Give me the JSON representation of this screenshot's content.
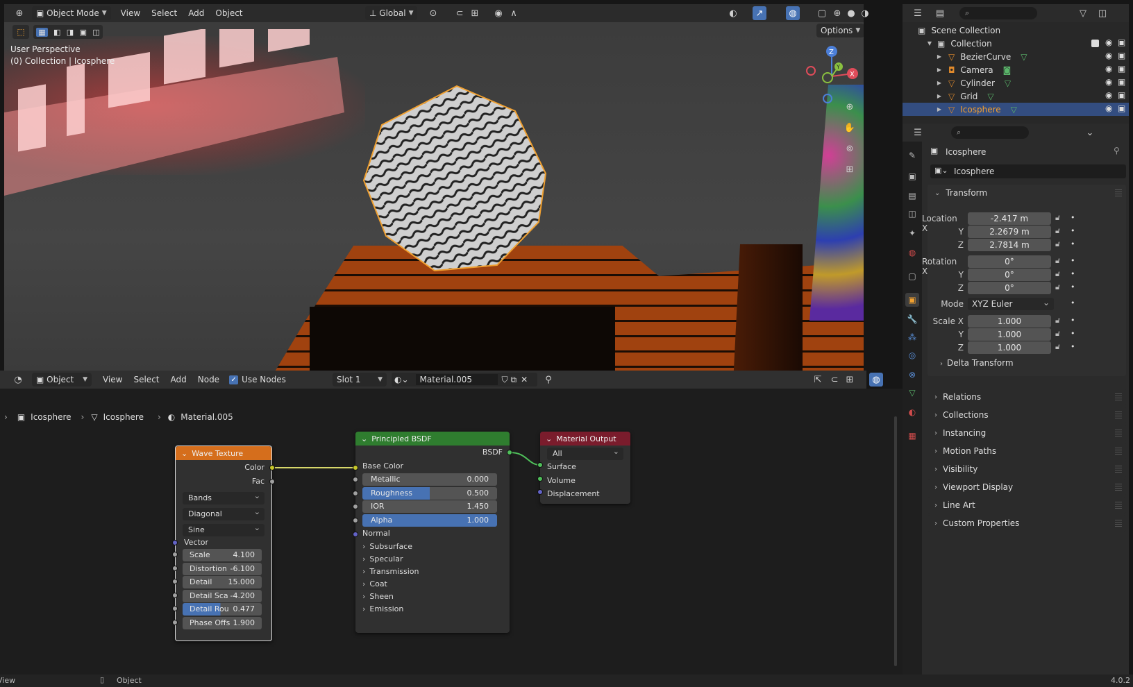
{
  "viewport": {
    "header": {
      "mode": "Object Mode",
      "menus": [
        "View",
        "Select",
        "Add",
        "Object"
      ],
      "transform_orientation": "Global",
      "options_label": "Options"
    },
    "overlay_text": {
      "perspective": "User Perspective",
      "context": "(0) Collection | Icosphere"
    },
    "gizmo": {
      "z": "Z",
      "y": "Y",
      "x": "X"
    }
  },
  "outliner": {
    "root": "Scene Collection",
    "collection": "Collection",
    "items": [
      {
        "label": "BezierCurve",
        "selected": false
      },
      {
        "label": "Camera",
        "selected": false
      },
      {
        "label": "Cylinder",
        "selected": false
      },
      {
        "label": "Grid",
        "selected": false
      },
      {
        "label": "Icosphere",
        "selected": true
      }
    ]
  },
  "properties": {
    "object_name_header": "Icosphere",
    "object_name_field": "Icosphere",
    "transform": {
      "title": "Transform",
      "location_label": "Location X",
      "y_label": "Y",
      "z_label": "Z",
      "location": [
        "-2.417 m",
        "2.2679 m",
        "2.7814 m"
      ],
      "rotation_label": "Rotation X",
      "rotation": [
        "0°",
        "0°",
        "0°"
      ],
      "mode_label": "Mode",
      "mode": "XYZ Euler",
      "scale_label": "Scale X",
      "scale": [
        "1.000",
        "1.000",
        "1.000"
      ],
      "delta": "Delta Transform"
    },
    "panels": [
      "Relations",
      "Collections",
      "Instancing",
      "Motion Paths",
      "Visibility",
      "Viewport Display",
      "Line Art",
      "Custom Properties"
    ]
  },
  "node_editor": {
    "header": {
      "type": "Object",
      "menus": [
        "View",
        "Select",
        "Add",
        "Node"
      ],
      "use_nodes": "Use Nodes",
      "slot": "Slot 1",
      "material": "Material.005"
    },
    "breadcrumb": [
      "Icosphere",
      "Icosphere",
      "Material.005"
    ],
    "wave": {
      "title": "Wave Texture",
      "out_color": "Color",
      "out_fac": "Fac",
      "type": "Bands",
      "direction": "Diagonal",
      "profile": "Sine",
      "vector": "Vector",
      "fields": [
        {
          "label": "Scale",
          "value": "4.100"
        },
        {
          "label": "Distortion",
          "value": "-6.100"
        },
        {
          "label": "Detail",
          "value": "15.000"
        },
        {
          "label": "Detail Sca",
          "value": "-4.200"
        },
        {
          "label": "Detail Rou",
          "value": "0.477"
        },
        {
          "label": "Phase Offs",
          "value": "1.900"
        }
      ]
    },
    "bsdf": {
      "title": "Principled BSDF",
      "out": "BSDF",
      "base_color": "Base Color",
      "fields": [
        {
          "label": "Metallic",
          "value": "0.000",
          "fill": 0
        },
        {
          "label": "Roughness",
          "value": "0.500",
          "fill": 0.5
        },
        {
          "label": "IOR",
          "value": "1.450",
          "fill": 0
        },
        {
          "label": "Alpha",
          "value": "1.000",
          "fill": 1
        }
      ],
      "normal": "Normal",
      "subpanels": [
        "Subsurface",
        "Specular",
        "Transmission",
        "Coat",
        "Sheen",
        "Emission"
      ]
    },
    "output": {
      "title": "Material Output",
      "target": "All",
      "inputs": [
        "Surface",
        "Volume",
        "Displacement"
      ]
    }
  },
  "statusbar": {
    "left": "View",
    "mid": "Object",
    "version": "4.0.2"
  }
}
